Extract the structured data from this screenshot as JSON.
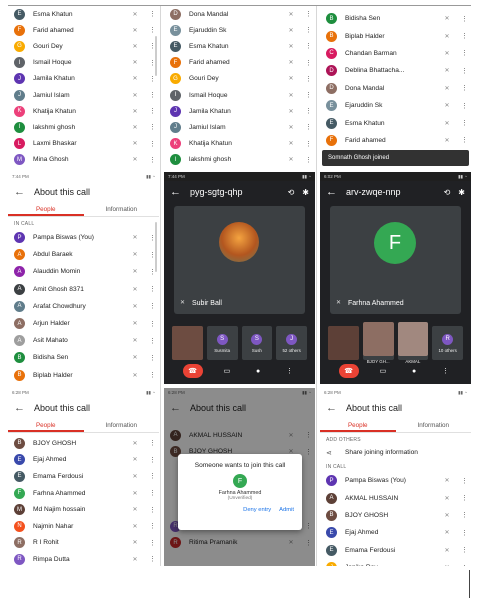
{
  "colors": {
    "accent": "#d93025",
    "end_call": "#ea4335",
    "link": "#1a73e8"
  },
  "top_left": {
    "rows": [
      {
        "initial": "E",
        "name": "Esma Khatun",
        "color": "#455a64"
      },
      {
        "initial": "F",
        "name": "Farid ahamed",
        "color": "#e8710a"
      },
      {
        "initial": "G",
        "name": "Gouri Dey",
        "color": "#f9ab00"
      },
      {
        "initial": "I",
        "name": "Ismail Hoque",
        "color": "#5f6368"
      },
      {
        "initial": "J",
        "name": "Jamila Khatun",
        "color": "#5e35b1"
      },
      {
        "initial": "J",
        "name": "Jamiul Islam",
        "color": "#607d8b"
      },
      {
        "initial": "K",
        "name": "Khatija Khatun",
        "color": "#ec407a"
      },
      {
        "initial": "l",
        "name": "lakshmi ghosh",
        "color": "#1e8e3e"
      },
      {
        "initial": "L",
        "name": "Laxmi Bhaskar",
        "color": "#d81b60"
      },
      {
        "initial": "M",
        "name": "Mina Ghosh",
        "color": "#7e57c2"
      }
    ]
  },
  "top_mid": {
    "rows": [
      {
        "initial": "D",
        "name": "Dona Mandal",
        "color": "#8d6e63"
      },
      {
        "initial": "E",
        "name": "Ejaruddin Sk",
        "color": "#78909c"
      },
      {
        "initial": "E",
        "name": "Esma Khatun",
        "color": "#455a64"
      },
      {
        "initial": "F",
        "name": "Farid ahamed",
        "color": "#e8710a"
      },
      {
        "initial": "G",
        "name": "Gouri Dey",
        "color": "#f9ab00"
      },
      {
        "initial": "I",
        "name": "Ismail Hoque",
        "color": "#5f6368"
      },
      {
        "initial": "J",
        "name": "Jamila Khatun",
        "color": "#5e35b1"
      },
      {
        "initial": "J",
        "name": "Jamiul Islam",
        "color": "#607d8b"
      },
      {
        "initial": "K",
        "name": "Khatija Khatun",
        "color": "#ec407a"
      },
      {
        "initial": "l",
        "name": "lakshmi ghosh",
        "color": "#1e8e3e"
      }
    ]
  },
  "top_right": {
    "rows": [
      {
        "initial": "B",
        "name": "Bidisha Sen",
        "color": "#1e8e3e"
      },
      {
        "initial": "B",
        "name": "Biplab Halder",
        "color": "#e8710a"
      },
      {
        "initial": "C",
        "name": "Chandan Barman",
        "color": "#d81b60"
      },
      {
        "initial": "D",
        "name": "Deblina Bhattacha...",
        "color": "#ad1457"
      },
      {
        "initial": "D",
        "name": "Dona Mandal",
        "color": "#8d6e63"
      },
      {
        "initial": "E",
        "name": "Ejaruddin Sk",
        "color": "#78909c"
      },
      {
        "initial": "E",
        "name": "Esma Khatun",
        "color": "#455a64"
      },
      {
        "initial": "F",
        "name": "Farid ahamed",
        "color": "#e8710a"
      }
    ],
    "toast": "Somnath Ghosh joined"
  },
  "mid_left": {
    "status": "7:44 PM",
    "title": "About this call",
    "tab_people": "People",
    "tab_info": "Information",
    "section": "IN CALL",
    "rows": [
      {
        "initial": "P",
        "name": "Pampa Biswas (You)",
        "color": "#5e35b1"
      },
      {
        "initial": "A",
        "name": "Abdul Baraek",
        "color": "#e8710a"
      },
      {
        "initial": "A",
        "name": "Alauddin Momin",
        "color": "#8e24aa"
      },
      {
        "initial": "A",
        "name": "Amit Ghosh 8371",
        "color": "#3c4043"
      },
      {
        "initial": "A",
        "name": "Arafat Chowdhury",
        "color": "#607d8b"
      },
      {
        "initial": "A",
        "name": "Arjun Halder",
        "color": "#8d6e63"
      },
      {
        "initial": "A",
        "name": "Asit Mahato",
        "color": "#9e9e9e"
      },
      {
        "initial": "B",
        "name": "Bidisha Sen",
        "color": "#1e8e3e"
      },
      {
        "initial": "B",
        "name": "Biplab Halder",
        "color": "#e8710a"
      },
      {
        "initial": "C",
        "name": "Chandan Barman",
        "color": "#d81b60"
      }
    ]
  },
  "mid_center": {
    "status": "7:44 PM",
    "meeting_code": "pyg-sgtg-qhp",
    "speaker": "Subir Ball",
    "thumbs": [
      {
        "label": "",
        "initial": "",
        "color": "#6d4c41"
      },
      {
        "label": "Susmita",
        "initial": "S",
        "color": "#7e57c2"
      },
      {
        "label": "Sush",
        "initial": "S",
        "color": "#7e57c2"
      },
      {
        "label": "52 others",
        "initial": "J",
        "color": "#7e57c2"
      }
    ]
  },
  "mid_right": {
    "status": "6:02 PM",
    "meeting_code": "arv-zwqe-nnp",
    "speaker": "Farhna Ahammed",
    "speaker_initial": "F",
    "speaker_color": "#34a853",
    "thumbs": [
      {
        "label": "",
        "initial": "",
        "color": "#5d4037"
      },
      {
        "label": "BJOY GH...",
        "initial": "",
        "color": "#8d6e63"
      },
      {
        "label": "AKMAL",
        "initial": "",
        "color": "#a1887f"
      },
      {
        "label": "10 others",
        "initial": "R",
        "color": "#7e57c2"
      }
    ]
  },
  "bot_left": {
    "status": "6:28 PM",
    "title": "About this call",
    "tab_people": "People",
    "tab_info": "Information",
    "rows": [
      {
        "initial": "B",
        "name": "BJOY GHOSH",
        "color": "#6d4c41"
      },
      {
        "initial": "E",
        "name": "Ejaj Ahmed",
        "color": "#3949ab"
      },
      {
        "initial": "E",
        "name": "Emama Ferdousi",
        "color": "#455a64"
      },
      {
        "initial": "F",
        "name": "Farhna Ahammed",
        "color": "#34a853"
      },
      {
        "initial": "M",
        "name": "Md Najim hossain",
        "color": "#5d4037"
      },
      {
        "initial": "N",
        "name": "Najmin Nahar",
        "color": "#f4511e"
      },
      {
        "initial": "R",
        "name": "R I Rohit",
        "color": "#8d6e63"
      },
      {
        "initial": "R",
        "name": "Rimpa Dutta",
        "color": "#7e57c2"
      },
      {
        "initial": "R",
        "name": "Ritima Pramanik",
        "color": "#c62828"
      }
    ]
  },
  "bot_mid": {
    "status": "6:28 PM",
    "title": "About this call",
    "rows_top": [
      {
        "initial": "A",
        "name": "AKMAL HUSSAIN",
        "color": "#5d4037"
      },
      {
        "initial": "B",
        "name": "BJOY GHOSH",
        "color": "#6d4c41"
      }
    ],
    "rows_bottom": [
      {
        "initial": "R",
        "name": "Rimpa Dutta",
        "color": "#7e57c2"
      },
      {
        "initial": "R",
        "name": "Ritima Pramanik",
        "color": "#c62828"
      }
    ],
    "dialog": {
      "title": "Someone wants to join this call",
      "initial": "F",
      "name": "Farhna Ahammed",
      "sub": "(Unverified)",
      "deny": "Deny entry",
      "admit": "Admit"
    }
  },
  "bot_right": {
    "status": "6:28 PM",
    "title": "About this call",
    "tab_people": "People",
    "tab_info": "Information",
    "section_add": "ADD OTHERS",
    "share": "Share joining information",
    "section": "IN CALL",
    "rows": [
      {
        "initial": "P",
        "name": "Pampa Biswas (You)",
        "color": "#5e35b1"
      },
      {
        "initial": "A",
        "name": "AKMAL HUSSAIN",
        "color": "#5d4037"
      },
      {
        "initial": "B",
        "name": "BJOY GHOSH",
        "color": "#6d4c41"
      },
      {
        "initial": "E",
        "name": "Ejaj Ahmed",
        "color": "#3949ab"
      },
      {
        "initial": "E",
        "name": "Emama Ferdousi",
        "color": "#455a64"
      },
      {
        "initial": "J",
        "name": "Jonika Roy",
        "color": "#f9ab00"
      }
    ]
  }
}
